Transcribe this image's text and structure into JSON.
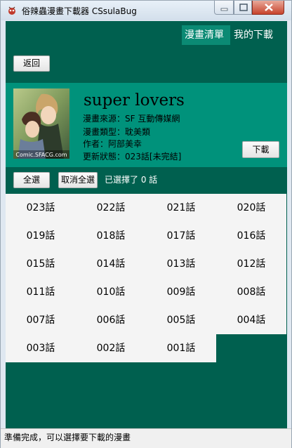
{
  "window": {
    "title": "俗辣蟲漫畫下載器 CSsulaBug",
    "buttons": {
      "minimize": "minimize",
      "maximize": "maximize",
      "close": "close"
    }
  },
  "nav": {
    "tabs": [
      "漫畫清單",
      "我的下載"
    ],
    "active_index": 0
  },
  "toolbar": {
    "back_label": "返回"
  },
  "comic": {
    "title": "super lovers",
    "source": "漫畫來源：SF 互動傳媒網",
    "genre": "漫畫類型：耽美類",
    "author": "作者：阿部美幸",
    "status": "更新狀態：023話[未完結]",
    "cover_watermark": "Comic.SFACG.com",
    "download_label": "下載"
  },
  "selection": {
    "select_all_label": "全選",
    "deselect_all_label": "取消全選",
    "selected_text": "已選擇了 0 話"
  },
  "chapters": [
    "023話",
    "022話",
    "021話",
    "020話",
    "019話",
    "018話",
    "017話",
    "016話",
    "015話",
    "014話",
    "013話",
    "012話",
    "011話",
    "010話",
    "009話",
    "008話",
    "007話",
    "006話",
    "005話",
    "004話",
    "003話",
    "002話",
    "001話"
  ],
  "statusbar": {
    "text": "準備完成，可以選擇要下載的漫畫"
  },
  "colors": {
    "panel_dark": "#00604f",
    "panel_light": "#00927b",
    "tab_active": "#0b8a74"
  }
}
